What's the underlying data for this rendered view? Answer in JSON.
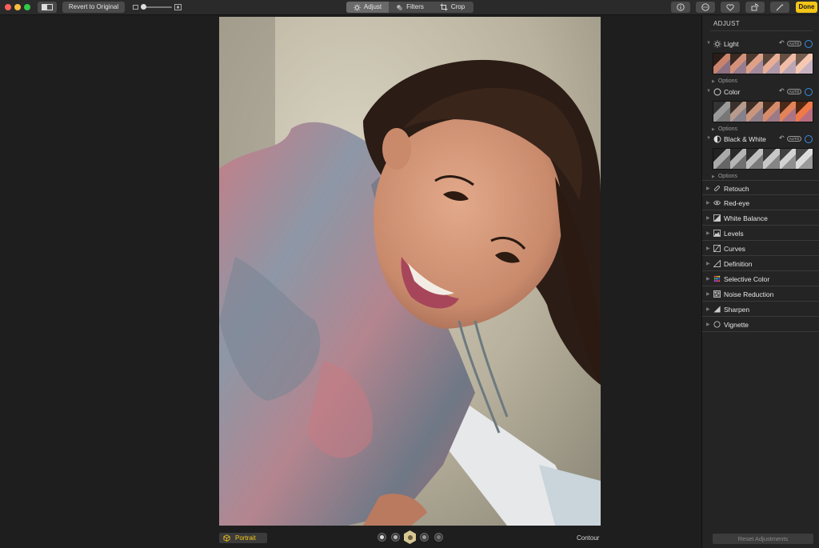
{
  "toolbar": {
    "revert_label": "Revert to Original",
    "tabs": [
      {
        "label": "Adjust",
        "icon": "sun-icon",
        "active": true
      },
      {
        "label": "Filters",
        "icon": "filters-icon",
        "active": false
      },
      {
        "label": "Crop",
        "icon": "crop-icon",
        "active": false
      }
    ],
    "done_label": "Done",
    "icons": [
      "info-icon",
      "more-icon",
      "heart-icon",
      "rotate-icon",
      "magic-wand-icon"
    ]
  },
  "bottom_bar": {
    "portrait_label": "Portrait",
    "lighting_label": "Contour"
  },
  "sidebar": {
    "title": "ADJUST",
    "sections": [
      {
        "label": "Light",
        "icon": "sun-icon",
        "auto": "AUTO",
        "options": "Options"
      },
      {
        "label": "Color",
        "icon": "color-circle-icon",
        "auto": "AUTO",
        "options": "Options"
      },
      {
        "label": "Black & White",
        "icon": "half-circle-icon",
        "auto": "AUTO",
        "options": "Options"
      }
    ],
    "tools": [
      {
        "label": "Retouch",
        "icon": "bandage-icon"
      },
      {
        "label": "Red-eye",
        "icon": "eye-icon"
      },
      {
        "label": "White Balance",
        "icon": "white-balance-icon"
      },
      {
        "label": "Levels",
        "icon": "levels-icon"
      },
      {
        "label": "Curves",
        "icon": "curves-icon"
      },
      {
        "label": "Definition",
        "icon": "definition-icon"
      },
      {
        "label": "Selective Color",
        "icon": "selective-color-icon"
      },
      {
        "label": "Noise Reduction",
        "icon": "noise-icon"
      },
      {
        "label": "Sharpen",
        "icon": "sharpen-icon"
      },
      {
        "label": "Vignette",
        "icon": "vignette-icon"
      }
    ],
    "reset_label": "Reset Adjustments"
  },
  "colors": {
    "accent_yellow": "#f5c518",
    "toggle_blue": "#3a8ee6"
  }
}
